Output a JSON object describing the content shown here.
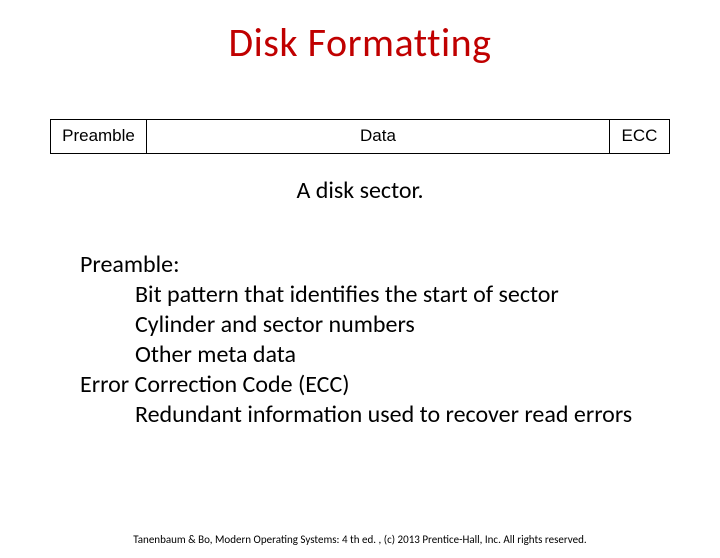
{
  "title": "Disk Formatting",
  "diagram": {
    "preamble": "Preamble",
    "data": "Data",
    "ecc": "ECC"
  },
  "caption": "A disk sector.",
  "body": {
    "preamble_heading": "Preamble:",
    "preamble_lines": [
      "Bit pattern that identifies the start of sector",
      "Cylinder and sector numbers",
      "Other meta data"
    ],
    "ecc_heading": "Error Correction Code (ECC)",
    "ecc_lines": [
      "Redundant information used to recover read errors"
    ]
  },
  "footer": "Tanenbaum & Bo, Modern Operating Systems: 4 th ed. , (c) 2013 Prentice-Hall, Inc. All rights reserved."
}
